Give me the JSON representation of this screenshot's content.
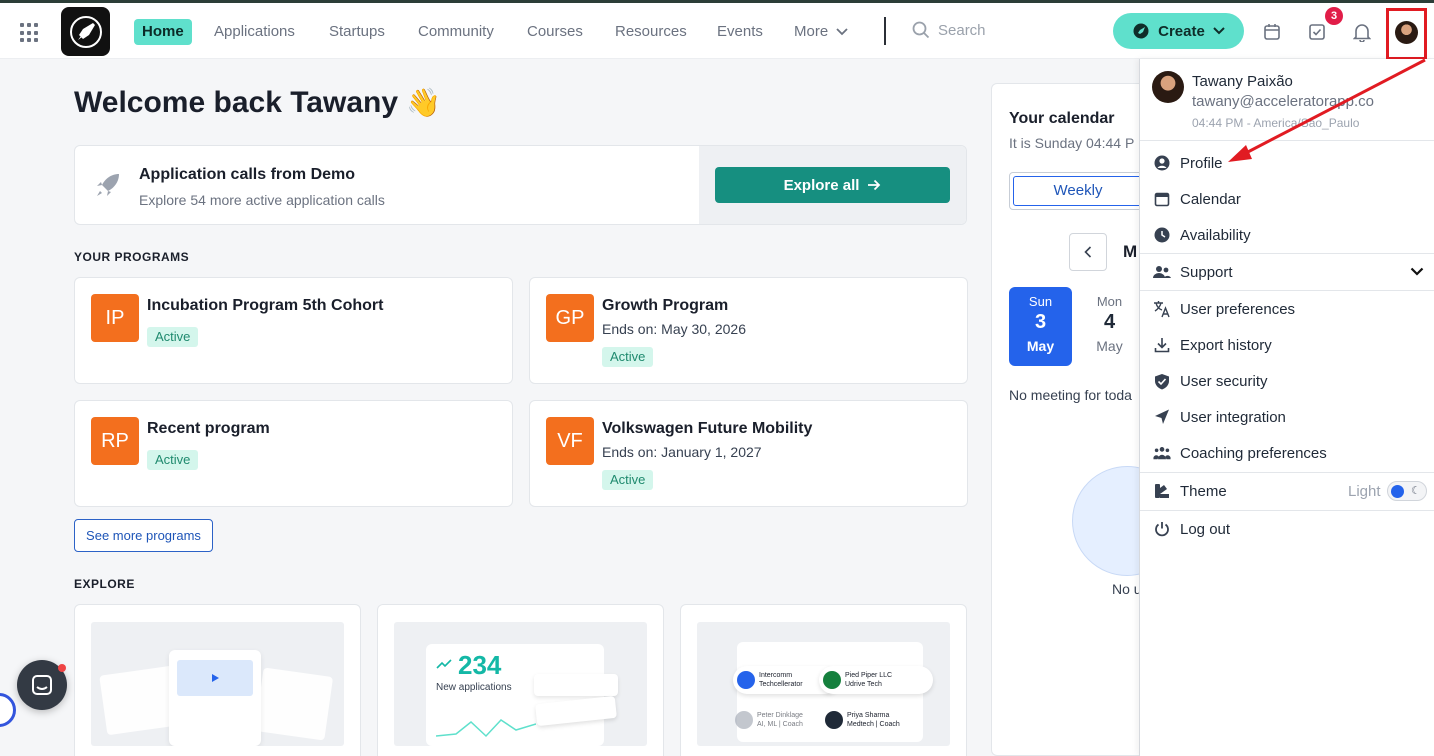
{
  "nav": {
    "items": [
      {
        "label": "Home",
        "active": true
      },
      {
        "label": "Applications"
      },
      {
        "label": "Startups"
      },
      {
        "label": "Community"
      },
      {
        "label": "Courses"
      },
      {
        "label": "Resources"
      },
      {
        "label": "Events"
      },
      {
        "label": "More"
      }
    ],
    "search_placeholder": "Search",
    "create_label": "Create",
    "tasks_badge": "3"
  },
  "main": {
    "welcome": "Welcome back Tawany",
    "welcome_emoji": "👋",
    "app_calls": {
      "title": "Application calls from Demo",
      "subtitle": "Explore 54 more active application calls",
      "button": "Explore all"
    },
    "programs_title": "YOUR PROGRAMS",
    "programs": [
      {
        "abbr": "IP",
        "name": "Incubation Program 5th Cohort",
        "ends": "",
        "status": "Active"
      },
      {
        "abbr": "GP",
        "name": "Growth Program",
        "ends": "Ends on: May 30, 2026",
        "status": "Active"
      },
      {
        "abbr": "RP",
        "name": "Recent program",
        "ends": "",
        "status": "Active"
      },
      {
        "abbr": "VF",
        "name": "Volkswagen Future Mobility",
        "ends": "Ends on: January 1, 2027",
        "status": "Active"
      }
    ],
    "see_more": "See more programs",
    "explore_title": "EXPLORE",
    "explore_cards": {
      "stat_value": "234",
      "stat_label": "New applications",
      "people": [
        {
          "name": "Intercomm",
          "role": "Techcellerator"
        },
        {
          "name": "Pied Piper LLC",
          "role": "Udrive Tech"
        },
        {
          "name": "Peter Dinklage",
          "role": "AI, ML | Coach"
        },
        {
          "name": "Priya Sharma",
          "role": "Medtech | Coach"
        }
      ]
    }
  },
  "calendar": {
    "title": "Your calendar",
    "subtitle": "It is Sunday 04:44 P",
    "view": "Weekly",
    "month_partial": "M",
    "days": [
      {
        "dow": "Sun",
        "num": "3",
        "mon": "May",
        "selected": true
      },
      {
        "dow": "Mon",
        "num": "4",
        "mon": "May",
        "selected": false
      }
    ],
    "no_meeting": "No meeting for toda",
    "no_partial": "No u"
  },
  "dropdown": {
    "user_name": "Tawany Paixão",
    "user_email": "tawany@acceleratorapp.co",
    "user_time": "04:44 PM - America/Sao_Paulo",
    "items": [
      {
        "label": "Profile",
        "icon": "user-circle-icon"
      },
      {
        "label": "Calendar",
        "icon": "calendar-icon"
      },
      {
        "label": "Availability",
        "icon": "clock-icon"
      },
      {
        "label": "Support",
        "icon": "users-icon"
      },
      {
        "label": "User preferences",
        "icon": "translate-icon"
      },
      {
        "label": "Export history",
        "icon": "download-icon"
      },
      {
        "label": "User security",
        "icon": "shield-icon"
      },
      {
        "label": "User integration",
        "icon": "share-icon"
      },
      {
        "label": "Coaching preferences",
        "icon": "group-icon"
      },
      {
        "label": "Theme",
        "icon": "palette-icon"
      },
      {
        "label": "Log out",
        "icon": "power-icon"
      }
    ],
    "theme_value": "Light"
  },
  "colors": {
    "accent": "#5fe0cc",
    "primary": "#168f80",
    "orange": "#f36f1e",
    "highlight": "#e11b22",
    "selected_day": "#2463eb"
  }
}
